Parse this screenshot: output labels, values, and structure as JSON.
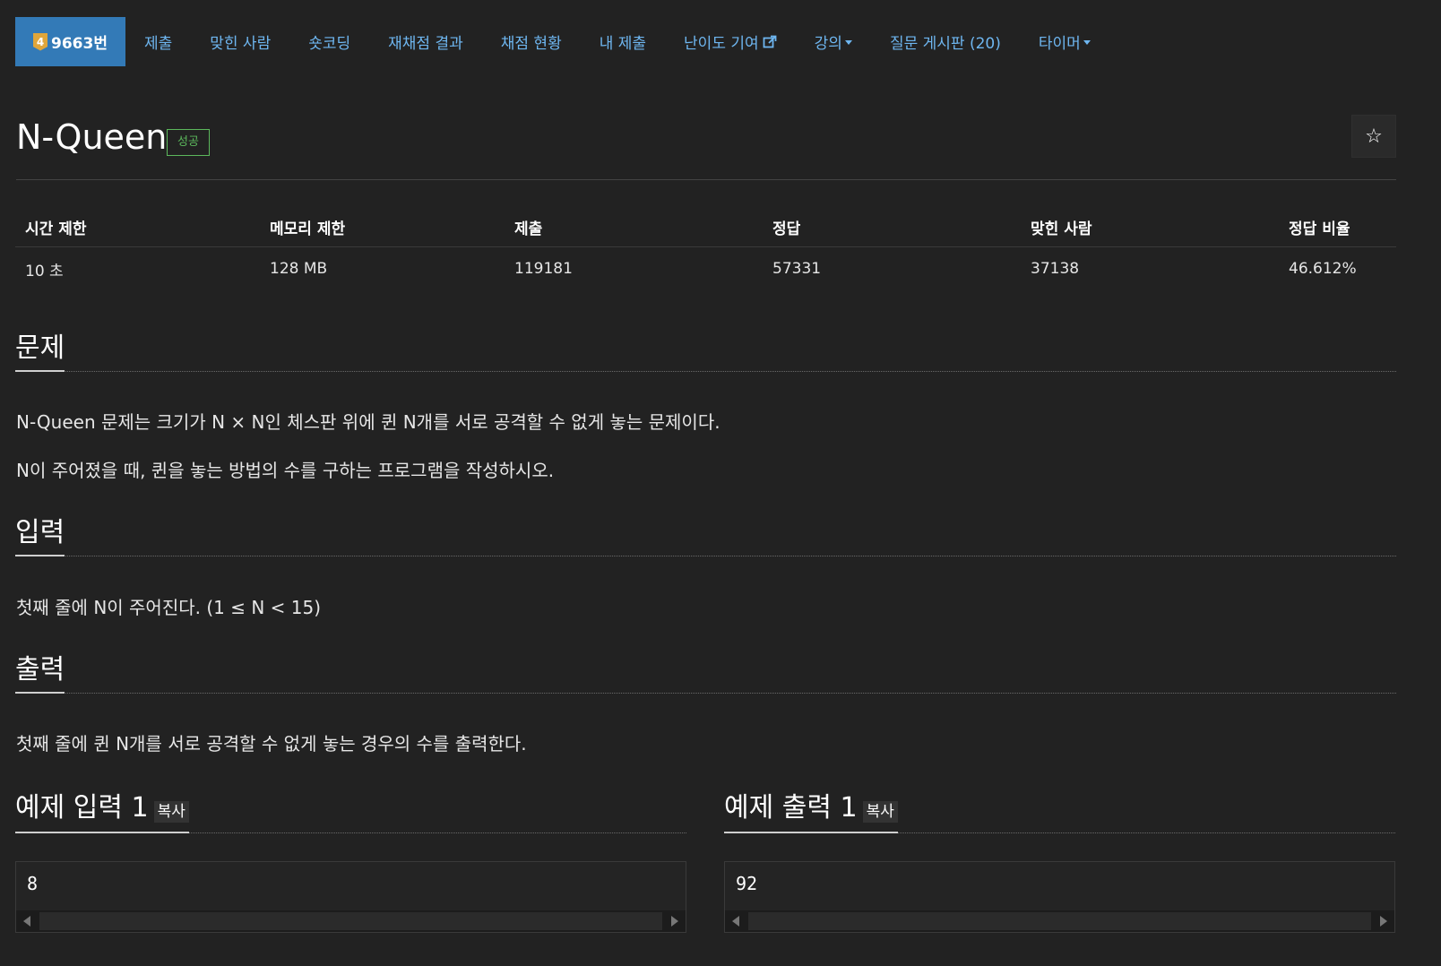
{
  "nav": {
    "tier": "4",
    "problem_number": "9663번",
    "items": [
      {
        "label": "제출"
      },
      {
        "label": "맞힌 사람"
      },
      {
        "label": "숏코딩"
      },
      {
        "label": "재채점 결과"
      },
      {
        "label": "채점 현황"
      },
      {
        "label": "내 제출"
      },
      {
        "label": "난이도 기여"
      },
      {
        "label": "강의"
      },
      {
        "label": "질문 게시판 (20)"
      },
      {
        "label": "타이머"
      }
    ]
  },
  "problem": {
    "title": "N-Queen",
    "status": "성공",
    "star": "☆"
  },
  "info": {
    "headers": [
      "시간 제한",
      "메모리 제한",
      "제출",
      "정답",
      "맞힌 사람",
      "정답 비율"
    ],
    "values": [
      "10 초",
      "128 MB",
      "119181",
      "57331",
      "37138",
      "46.612%"
    ]
  },
  "sections": {
    "description_title": "문제",
    "description": [
      "N-Queen 문제는 크기가 N × N인 체스판 위에 퀸 N개를 서로 공격할 수 없게 놓는 문제이다.",
      "N이 주어졌을 때, 퀸을 놓는 방법의 수를 구하는 프로그램을 작성하시오."
    ],
    "input_title": "입력",
    "input": "첫째 줄에 N이 주어진다. (1 ≤ N < 15)",
    "output_title": "출력",
    "output": "첫째 줄에 퀸 N개를 서로 공격할 수 없게 놓는 경우의 수를 출력한다."
  },
  "samples": {
    "input_title": "예제 입력 1",
    "output_title": "예제 출력 1",
    "copy_label": "복사",
    "input_value": "8",
    "output_value": "92"
  },
  "colors": {
    "background": "#222222",
    "nav_active": "#337ab7",
    "nav_link": "#6eb6f0",
    "success": "#5cb85c",
    "tier_gold": "#e0a63b"
  }
}
